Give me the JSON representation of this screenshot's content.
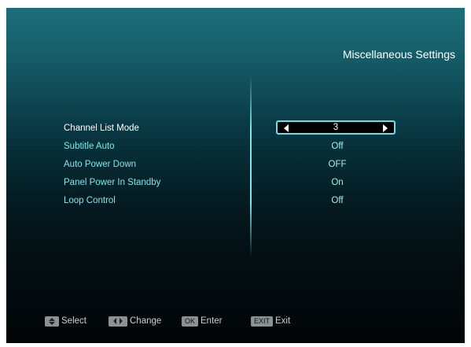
{
  "header": {
    "title": "Miscellaneous Settings"
  },
  "settings": [
    {
      "label": "Channel List Mode",
      "value": "3",
      "selected": true
    },
    {
      "label": "Subtitle Auto",
      "value": "Off"
    },
    {
      "label": "Auto Power Down",
      "value": "OFF"
    },
    {
      "label": "Panel Power In Standby",
      "value": "On"
    },
    {
      "label": "Loop Control",
      "value": "Off"
    }
  ],
  "footer": {
    "select_label": "Select",
    "change_label": "Change",
    "ok_key": "OK",
    "enter_label": "Enter",
    "exit_key": "EXIT",
    "exit_label": "Exit"
  },
  "colors": {
    "accent": "#6ee0e4",
    "label_active": "#ffffff",
    "label_inactive": "#7fe6ea"
  }
}
